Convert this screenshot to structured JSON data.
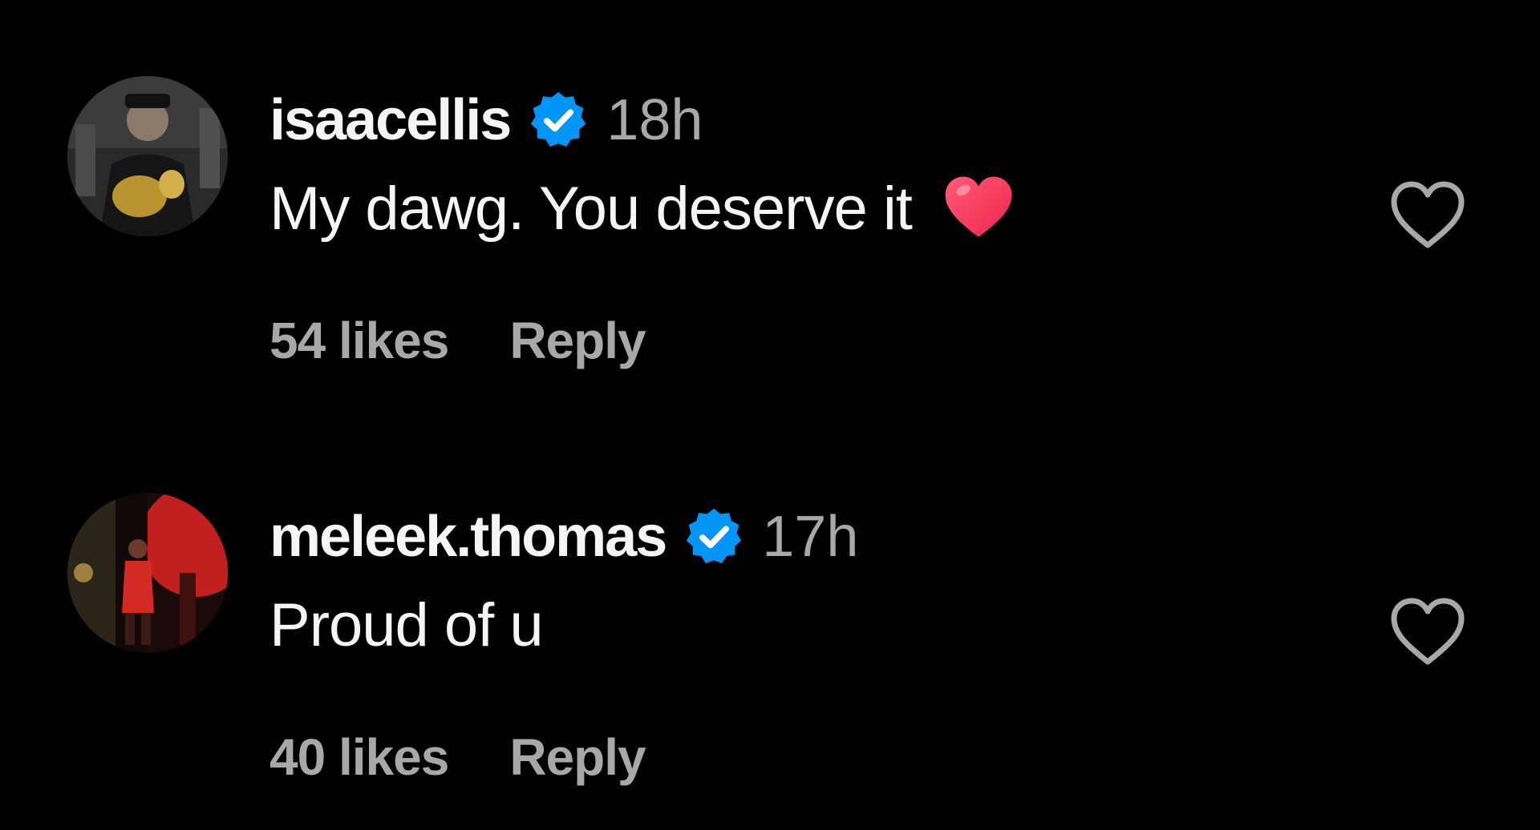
{
  "comments": [
    {
      "username": "isaacellis",
      "verified": true,
      "time": "18h",
      "text": "My dawg. You deserve it",
      "emoji": "red-heart-icon",
      "likes": "54 likes",
      "reply": "Reply"
    },
    {
      "username": "meleek.thomas",
      "verified": true,
      "time": "17h",
      "text": "Proud of u",
      "likes": "40 likes",
      "reply": "Reply"
    }
  ],
  "colors": {
    "background": "#000000",
    "primary_text": "#f5f5f5",
    "secondary_text": "#a8a8a8",
    "verified_badge": "#0095f6",
    "heart_emoji": "#ff3b5c"
  }
}
